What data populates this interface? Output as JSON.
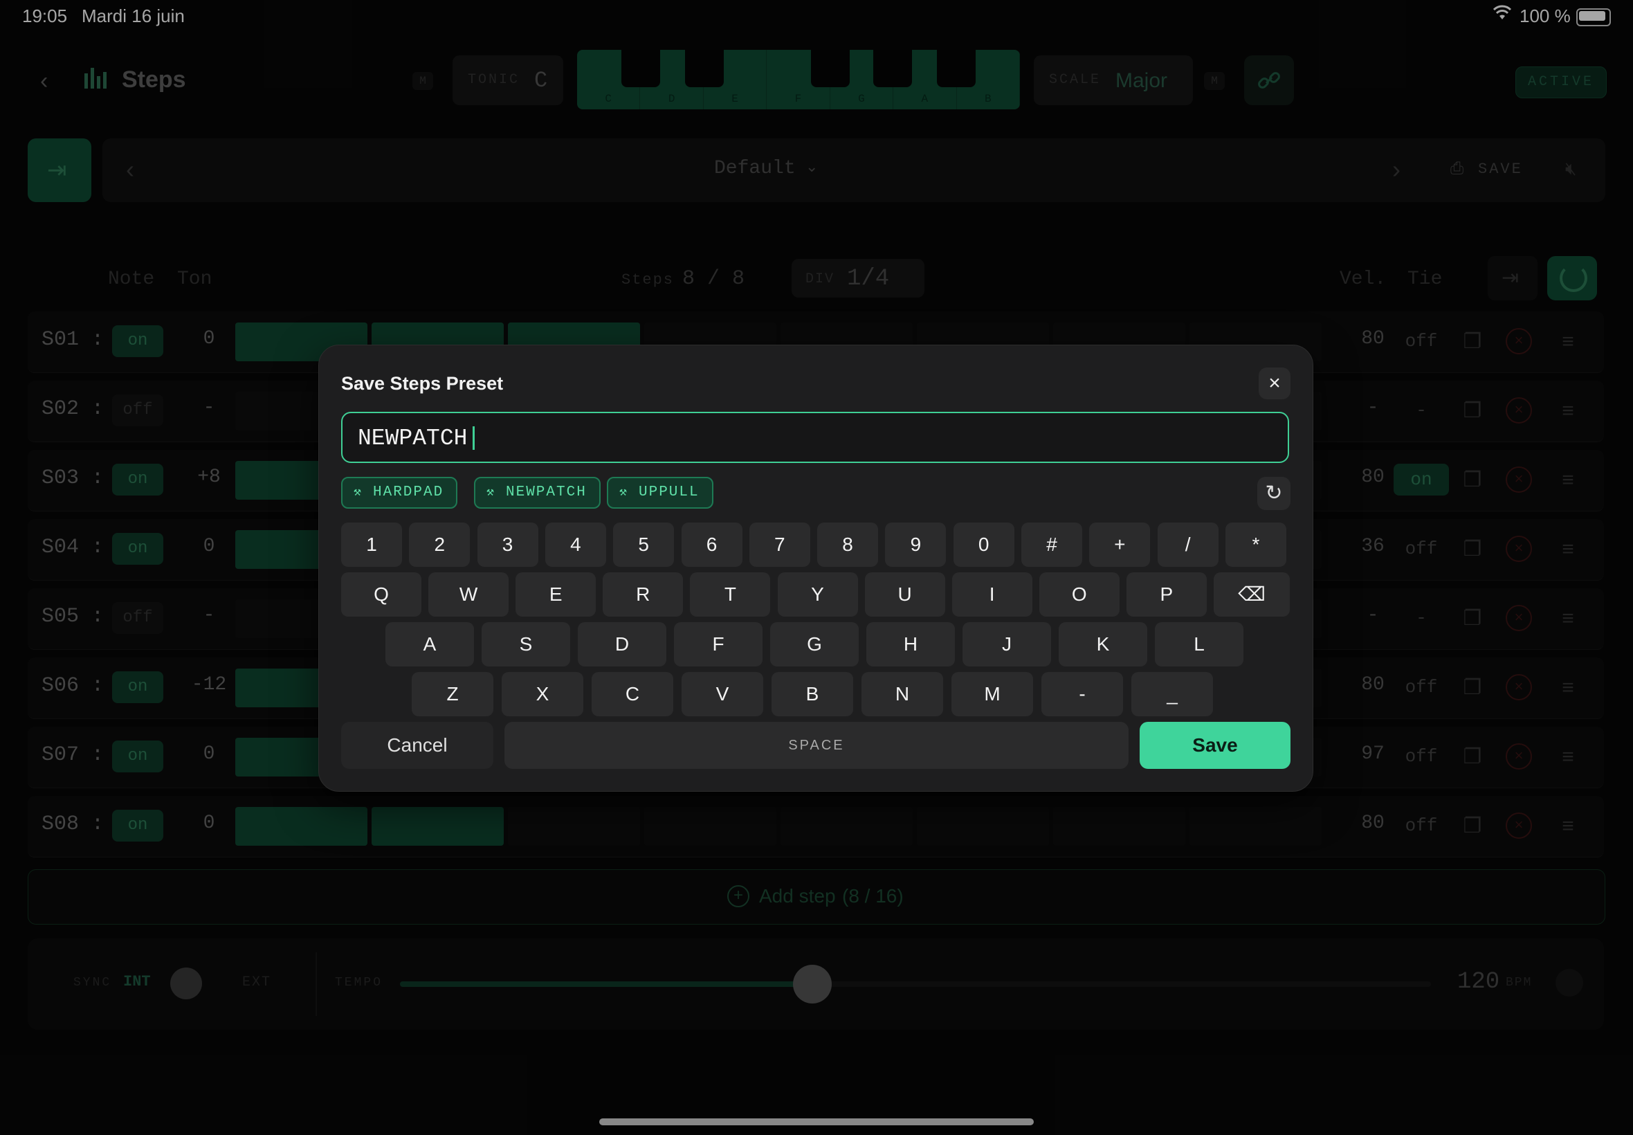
{
  "status": {
    "time": "19:05",
    "date": "Mardi 16 juin",
    "battery": "100 %"
  },
  "header": {
    "title": "Steps",
    "tonic_label": "TONIC",
    "tonic_value": "C",
    "scale_label": "SCALE",
    "scale_value": "Major",
    "m_badge": "M",
    "active_label": "ACTIVE",
    "piano_keys": [
      "C",
      "D",
      "E",
      "F",
      "G",
      "A",
      "B"
    ]
  },
  "preset_bar": {
    "name": "Default",
    "save_label": "SAVE"
  },
  "columns": {
    "note": "Note",
    "ton": "Ton",
    "steps_label": "Steps",
    "steps_value": "8 / 8",
    "div_label": "DIV",
    "div_value": "1/4",
    "vel": "Vel.",
    "tie": "Tie"
  },
  "steps": [
    {
      "label": "S01 :",
      "state": "on",
      "ton": "0",
      "vel": "80",
      "tie": "off",
      "fills": 3
    },
    {
      "label": "S02 :",
      "state": "off",
      "ton": "-",
      "vel": "-",
      "tie": "-",
      "fills": 0
    },
    {
      "label": "S03 :",
      "state": "on",
      "ton": "+8",
      "vel": "80",
      "tie": "on",
      "fills": 1
    },
    {
      "label": "S04 :",
      "state": "on",
      "ton": "0",
      "vel": "36",
      "tie": "off",
      "fills": 1
    },
    {
      "label": "S05 :",
      "state": "off",
      "ton": "-",
      "vel": "-",
      "tie": "-",
      "fills": 0
    },
    {
      "label": "S06 :",
      "state": "on",
      "ton": "-12",
      "vel": "80",
      "tie": "off",
      "fills": 1
    },
    {
      "label": "S07 :",
      "state": "on",
      "ton": "0",
      "vel": "97",
      "tie": "off",
      "fills": 1
    },
    {
      "label": "S08 :",
      "state": "on",
      "ton": "0",
      "vel": "80",
      "tie": "off",
      "fills": 2
    }
  ],
  "add_step": {
    "label": "Add step",
    "count": "(8 / 16)"
  },
  "transport": {
    "sync_label": "SYNC",
    "int_label": "INT",
    "ext_label": "EXT",
    "tempo_label": "TEMPO",
    "tempo_value": "120",
    "bpm_label": "BPM",
    "tempo_fraction": 0.4
  },
  "dialog": {
    "title": "Save Steps Preset",
    "input_value": "NEWPATCH",
    "suggestions": [
      "HARDPAD",
      "NEWPATCH",
      "UPPULL"
    ],
    "keyboard": {
      "row1": [
        "1",
        "2",
        "3",
        "4",
        "5",
        "6",
        "7",
        "8",
        "9",
        "0",
        "#",
        "+",
        "/",
        "*"
      ],
      "row2": [
        "Q",
        "W",
        "E",
        "R",
        "T",
        "Y",
        "U",
        "I",
        "O",
        "P"
      ],
      "row3": [
        "A",
        "S",
        "D",
        "F",
        "G",
        "H",
        "J",
        "K",
        "L"
      ],
      "row4": [
        "Z",
        "X",
        "C",
        "V",
        "B",
        "N",
        "M",
        "-",
        "_"
      ]
    },
    "cancel_label": "Cancel",
    "space_label": "SPACE",
    "save_label": "Save"
  },
  "icons": {
    "back": "chevron-left-icon",
    "bars": "bars-icon",
    "link": "link-icon",
    "backspace": "backspace-icon",
    "close": "close-icon",
    "refresh": "refresh-icon",
    "sparkle": "sparkle-icon"
  },
  "colors": {
    "accent": "#3fd49b",
    "accent_dim": "#0f4a33",
    "background": "#070707",
    "dialog": "#1e1e1f"
  }
}
